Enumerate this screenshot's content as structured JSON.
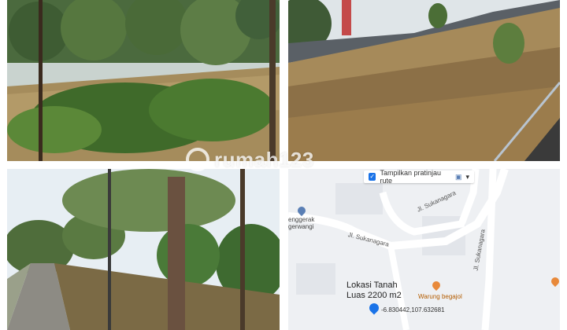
{
  "watermark": {
    "text": "rumah123"
  },
  "map": {
    "route_toggle": "Tampilkan pratinjau rute",
    "streets": [
      "Jl. Sukanagara",
      "Jl. Sukanagara",
      "Jl. Sukanagara"
    ],
    "left_label": [
      "enggerak",
      "gerwangi"
    ],
    "poi": "Warung begajol",
    "location_title": "Lokasi Tanah",
    "location_size": "Luas 2200 m2",
    "coordinates": "-6.830442,107.632681"
  },
  "colors": {
    "accent": "#1a73e8",
    "poi": "#e8893a",
    "map_bg": "#eef0f3"
  }
}
